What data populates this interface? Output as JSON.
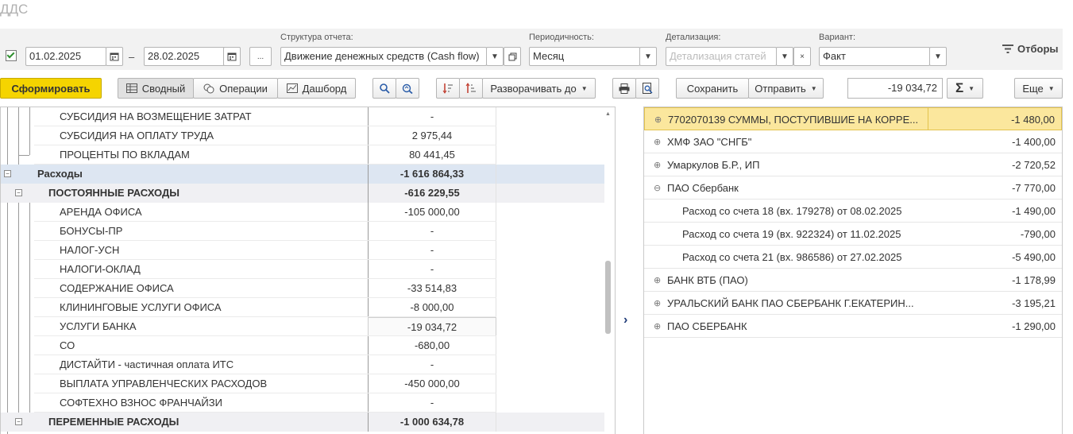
{
  "app": {
    "title": "ДДС"
  },
  "filters": {
    "period_enabled": true,
    "date_from": "01.02.2025",
    "date_sep": "–",
    "date_to": "28.02.2025",
    "more_label": "...",
    "structure_label": "Структура отчета:",
    "structure_value": "Движение денежных средств (Cash flow)",
    "periodicity_label": "Периодичность:",
    "periodicity_value": "Месяц",
    "detail_label": "Детализация:",
    "detail_placeholder": "Детализация статей",
    "variant_label": "Вариант:",
    "variant_value": "Факт",
    "filters_button": "Отборы"
  },
  "toolbar": {
    "generate": "Сформировать",
    "summary": "Сводный",
    "operations": "Операции",
    "dashboard": "Дашборд",
    "expand_to": "Разворачивать до",
    "save": "Сохранить",
    "send": "Отправить",
    "sum_value": "-19 034,72",
    "sum_symbol": "Σ",
    "more": "Еще"
  },
  "report": {
    "rows": [
      {
        "name": "СУБСИДИЯ НА ВОЗМЕЩЕНИЕ ЗАТРАТ",
        "value": "-"
      },
      {
        "name": "СУБСИДИЯ НА ОПЛАТУ ТРУДА",
        "value": "2 975,44"
      },
      {
        "name": "ПРОЦЕНТЫ ПО ВКЛАДАМ",
        "value": "80 441,45"
      },
      {
        "name": "Расходы",
        "value": "-1 616 864,33"
      },
      {
        "name": "ПОСТОЯННЫЕ РАСХОДЫ",
        "value": "-616 229,55"
      },
      {
        "name": "АРЕНДА ОФИСА",
        "value": "-105 000,00"
      },
      {
        "name": "БОНУСЫ-ПР",
        "value": "-"
      },
      {
        "name": "НАЛОГ-УСН",
        "value": "-"
      },
      {
        "name": "НАЛОГИ-ОКЛАД",
        "value": "-"
      },
      {
        "name": "СОДЕРЖАНИЕ ОФИСА",
        "value": "-33 514,83"
      },
      {
        "name": "КЛИНИНГОВЫЕ УСЛУГИ ОФИСА",
        "value": "-8 000,00"
      },
      {
        "name": "УСЛУГИ БАНКА",
        "value": "-19 034,72"
      },
      {
        "name": "СО",
        "value": "-680,00"
      },
      {
        "name": "ДИСТАЙТИ - частичная оплата ИТС",
        "value": "-"
      },
      {
        "name": "ВЫПЛАТА УПРАВЛЕНЧЕСКИХ РАСХОДОВ",
        "value": "-450 000,00"
      },
      {
        "name": "СОФТЕХНО ВЗНОС ФРАНЧАЙЗИ",
        "value": "-"
      },
      {
        "name": "ПЕРЕМЕННЫЕ РАСХОДЫ",
        "value": "-1 000 634,78"
      }
    ]
  },
  "details": {
    "rows": [
      {
        "name": "7702070139 СУММЫ, ПОСТУПИВШИЕ НА КОРРЕ...",
        "value": "-1 480,00"
      },
      {
        "name": "ХМФ ЗАО \"СНГБ\"",
        "value": "-1 400,00"
      },
      {
        "name": "Умаркулов Б.Р., ИП",
        "value": "-2 720,52"
      },
      {
        "name": "ПАО Сбербанк",
        "value": "-7 770,00"
      },
      {
        "name": "Расход со счета 18 (вх. 179278) от 08.02.2025",
        "value": "-1 490,00"
      },
      {
        "name": "Расход со счета 19 (вх. 922324) от 11.02.2025",
        "value": "-790,00"
      },
      {
        "name": "Расход со счета 21 (вх. 986586) от 27.02.2025",
        "value": "-5 490,00"
      },
      {
        "name": "БАНК ВТБ (ПАО)",
        "value": "-1 178,99"
      },
      {
        "name": "УРАЛЬСКИЙ БАНК ПАО СБЕРБАНК Г.ЕКАТЕРИН...",
        "value": "-3 195,21"
      },
      {
        "name": "ПАО СБЕРБАНК",
        "value": "-1 290,00"
      }
    ]
  },
  "colors": {
    "primary_button": "#f5d400",
    "group_row": "#dde6f2",
    "selected_row": "#fbe79d",
    "checkmark": "#2f8f2f"
  }
}
